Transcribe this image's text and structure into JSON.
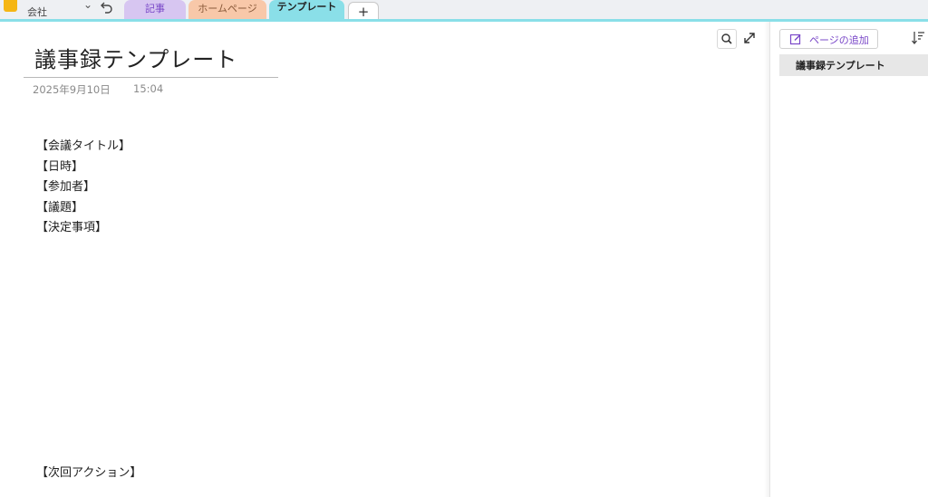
{
  "app": {
    "notebook_name": "会社"
  },
  "tabs": [
    {
      "label": "記事",
      "color": "#d7c6f1"
    },
    {
      "label": "ホームページ",
      "color": "#f8c8a9"
    },
    {
      "label": "テンプレート",
      "color": "#8adfe8",
      "active": true
    }
  ],
  "toolbar": {
    "add_section": "+",
    "undo_icon": "undo-icon",
    "search_icon": "search-icon",
    "expand_icon": "expand-icon"
  },
  "page": {
    "title": "議事録テンプレート",
    "date": "2025年9月10日",
    "time": "15:04",
    "lines": [
      "【会議タイトル】",
      "【日時】",
      "【参加者】",
      "【議題】",
      "【決定事項】"
    ],
    "next_action": "【次回アクション】"
  },
  "page_list": {
    "add_page_label": "ページの追加",
    "sort_icon": "sort-icon",
    "items": [
      {
        "label": "議事録テンプレート",
        "selected": true
      }
    ]
  }
}
